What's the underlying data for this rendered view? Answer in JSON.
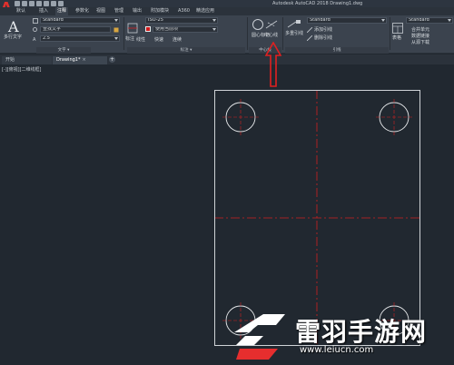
{
  "window": {
    "title": "Autodesk AutoCAD 2018   Drawing1.dwg"
  },
  "ribbon_tabs": [
    "默认",
    "插入",
    "注释",
    "参数化",
    "视图",
    "管理",
    "输出",
    "附加模块",
    "A360",
    "精选应用"
  ],
  "annotation_panel": {
    "mtext_label": "多行文字",
    "text_style": "Standard",
    "text_find": "查找文字",
    "text_height": "2.5",
    "panel_title": "文字 ▾"
  },
  "dimension_panel": {
    "dim_style": "ISO-25",
    "label": "标注"
  },
  "layer_panel": {
    "layer_current": "使用当前项",
    "panel_title": "标注 ▾",
    "linear": "线性",
    "quick": "快速",
    "continue": "连续"
  },
  "centerline_panel": {
    "center_mark": "圆心标记",
    "centerline": "中心线",
    "panel_title": "中心线"
  },
  "leader_panel": {
    "multileader": "多重引线",
    "style": "Standard",
    "add_leader": "添加引线",
    "remove_leader": "删除引线",
    "panel_title": "引线"
  },
  "table_panel": {
    "style": "Standard",
    "table_label": "表格",
    "merge": "合并单元",
    "data_link": "数据链接",
    "extract": "从源下载"
  },
  "doc_tabs": {
    "start": "开始",
    "drawing": "Drawing1*",
    "plus": "+"
  },
  "viewport_label": "[-][俯视][二维线框]",
  "watermark": {
    "title": "雷羽手游网",
    "url": "www.leiucn.com"
  },
  "colors": {
    "background": "#212830",
    "centerline": "#d02020",
    "geometry": "#e8eaec",
    "arrow": "#e02020"
  }
}
